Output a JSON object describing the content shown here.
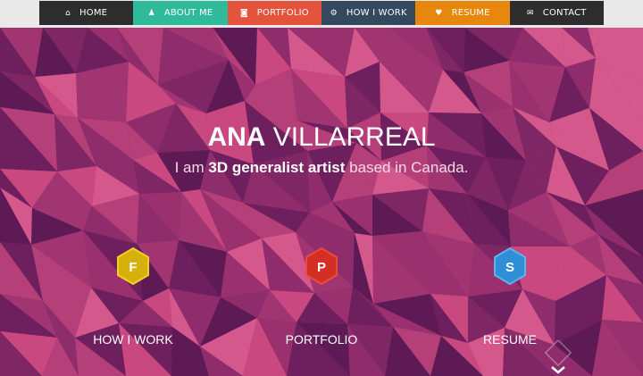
{
  "nav": {
    "items": [
      {
        "label": "HOME",
        "icon": "home-icon",
        "glyph": "⌂",
        "color": "#2d2d2d"
      },
      {
        "label": "ABOUT ME",
        "icon": "user-icon",
        "glyph": "♟",
        "color": "#2fba9b"
      },
      {
        "label": "PORTFOLIO",
        "icon": "camera-icon",
        "glyph": "◙",
        "color": "#e4533b"
      },
      {
        "label": "HOW I WORK",
        "icon": "gears-icon",
        "glyph": "⚙",
        "color": "#34495e"
      },
      {
        "label": "RESUME",
        "icon": "heart-icon",
        "glyph": "♥",
        "color": "#e8870e"
      },
      {
        "label": "CONTACT",
        "icon": "envelope-icon",
        "glyph": "✉",
        "color": "#2d2d2d"
      }
    ]
  },
  "hero": {
    "name_first": "ANA",
    "name_last": " VILLARREAL",
    "tagline_pre": "I am ",
    "tagline_bold": "3D generalist artist",
    "tagline_post": " based in Canada."
  },
  "features": [
    {
      "letter": "F",
      "label": "HOW I WORK",
      "color": "#d6b10c",
      "border": "#f2cf2a"
    },
    {
      "letter": "P",
      "label": "PORTFOLIO",
      "color": "#d42f24",
      "border": "#ea4b3a"
    },
    {
      "letter": "S",
      "label": "RESUME",
      "color": "#2e8fd6",
      "border": "#5fb2ec"
    }
  ],
  "scroll_icon": "chevron-down-icon"
}
